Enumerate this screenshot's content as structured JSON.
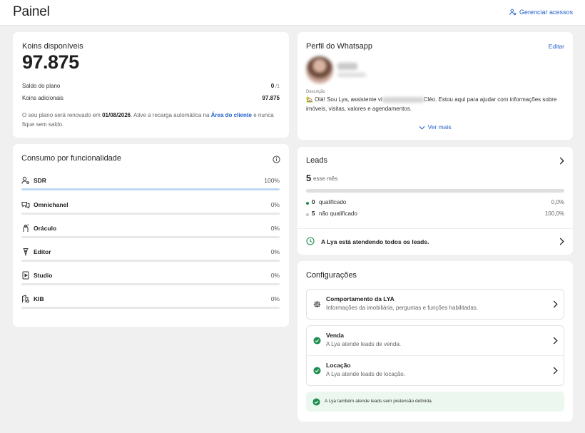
{
  "header": {
    "title": "Painel",
    "manage_label": "Gerenciar acessos"
  },
  "koins": {
    "title": "Koins disponíveis",
    "total": "97.875",
    "plan_balance_label": "Saldo do plano",
    "plan_balance_value": "0",
    "plan_balance_suffix": "/1",
    "extra_label": "Koins adicionais",
    "extra_value": "97.875",
    "renew_pre": "O seu plano será renovado em ",
    "renew_date": "01/08/2026",
    "renew_mid": ". Ative a recarga automática na ",
    "renew_link": "Área do cliente",
    "renew_post": " e nunca fique sem saldo."
  },
  "consumo": {
    "title": "Consumo por funcionalidade",
    "items": [
      {
        "label": "SDR",
        "percent_label": "100%",
        "percent": 100,
        "icon": "user-gear-icon"
      },
      {
        "label": "Omnichanel",
        "percent_label": "0%",
        "percent": 0,
        "icon": "chat-bubbles-icon"
      },
      {
        "label": "Oráculo",
        "percent_label": "0%",
        "percent": 0,
        "icon": "oracle-icon"
      },
      {
        "label": "Editor",
        "percent_label": "0%",
        "percent": 0,
        "icon": "pen-nib-icon"
      },
      {
        "label": "Studio",
        "percent_label": "0%",
        "percent": 0,
        "icon": "play-file-icon"
      },
      {
        "label": "KIB",
        "percent_label": "0%",
        "percent": 0,
        "icon": "building-gear-icon"
      }
    ]
  },
  "perfil": {
    "title": "Perfil do Whatsapp",
    "edit_label": "Editar",
    "desc_label": "Descrição",
    "desc_pre": "🏡 Olá! Sou Lya, assistente vi",
    "desc_post": "Cléo. Estou aqui para ajudar com informações sobre imóveis, visitas, valores e agendamentos.",
    "more_label": "Ver mais"
  },
  "leads": {
    "title": "Leads",
    "count": "5",
    "period": "esse mês",
    "legend": [
      {
        "count": "0",
        "label": "qualificado",
        "percent": "0,0%",
        "color": "#1e8e4e"
      },
      {
        "count": "5",
        "label": "não qualificado",
        "percent": "100,0%",
        "color": "#c4c4c4"
      }
    ],
    "status": "A Lya está atendendo todos os leads."
  },
  "config": {
    "title": "Configurações",
    "behavior_title": "Comportamento da LYA",
    "behavior_sub": "Informações da imobiliária, perguntas e funções habilitadas.",
    "venda_title": "Venda",
    "venda_sub": "A Lya atende leads de venda.",
    "locacao_title": "Locação",
    "locacao_sub": "A Lya atende leads de locação.",
    "note": "A Lya também atende leads sem pretensão definida."
  },
  "colors": {
    "accent": "#2563c9",
    "success": "#1e8e4e",
    "progress": "#bcd8f2",
    "note_bg": "#ecf8ef"
  }
}
